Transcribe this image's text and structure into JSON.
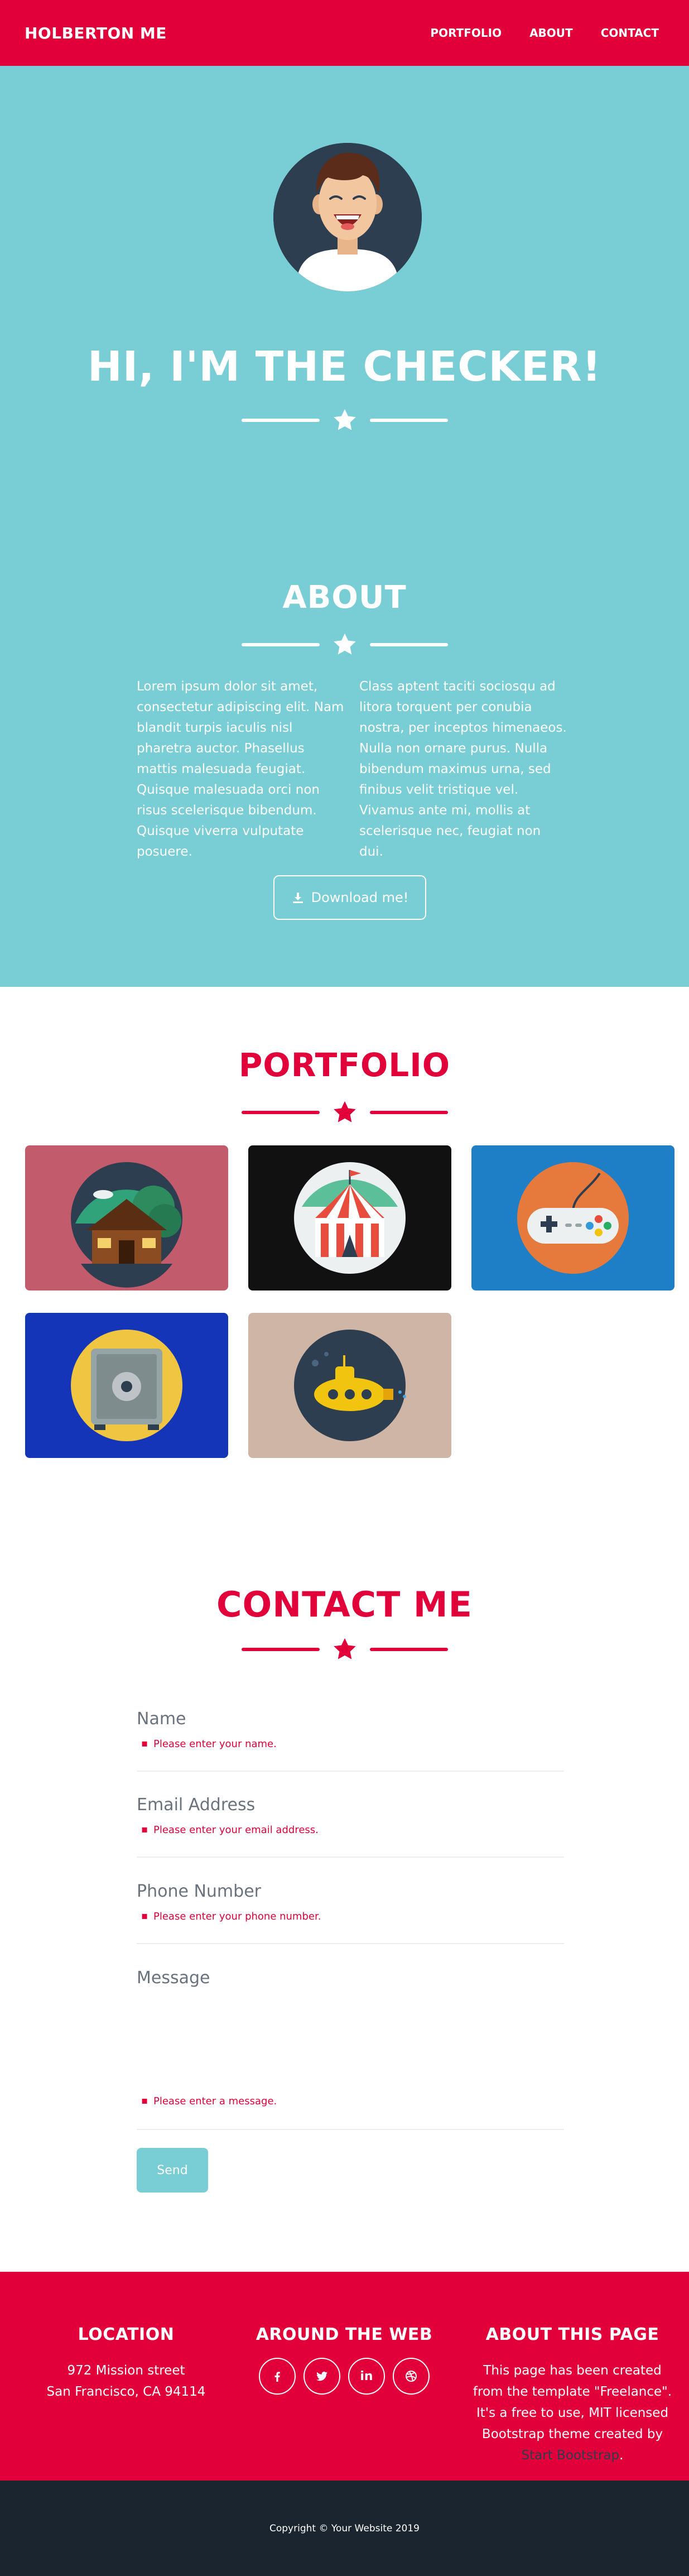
{
  "nav": {
    "brand": "HOLBERTON ME",
    "links": [
      "PORTFOLIO",
      "ABOUT",
      "CONTACT"
    ]
  },
  "hero": {
    "title": "HI, I'M THE CHECKER!"
  },
  "about": {
    "title": "ABOUT",
    "text_left": "Lorem ipsum dolor sit amet, consectetur adipiscing elit. Nam blandit turpis iaculis nisl pharetra auctor. Phasellus mattis malesuada feugiat. Quisque malesuada orci non risus scelerisque bibendum. Quisque viverra vulputate posuere.",
    "text_right": "Class aptent taciti sociosqu ad litora torquent per conubia nostra, per inceptos himenaeos. Nulla non ornare purus. Nulla bibendum maximus urna, sed finibus velit tristique vel. Vivamus ante mi, mollis at scelerisque nec, feugiat non dui.",
    "download_label": "Download me!"
  },
  "portfolio": {
    "title": "PORTFOLIO"
  },
  "contact": {
    "title": "CONTACT ME",
    "fields": [
      {
        "label": "Name",
        "error": "Please enter your name."
      },
      {
        "label": "Email Address",
        "error": "Please enter your email address."
      },
      {
        "label": "Phone Number",
        "error": "Please enter your phone number."
      },
      {
        "label": "Message",
        "error": "Please enter a message."
      }
    ],
    "send_label": "Send"
  },
  "footer": {
    "location_title": "LOCATION",
    "location_line1": "972 Mission street",
    "location_line2": "San Francisco, CA 94114",
    "web_title": "AROUND THE WEB",
    "socials": [
      "facebook-icon",
      "twitter-icon",
      "linkedin-icon",
      "dribbble-icon"
    ],
    "about_title": "ABOUT THIS PAGE",
    "about_text": "This page has been created from the template \"Freelance\". It's a free to use, MIT licensed Bootstrap theme created by",
    "about_link": "Start Bootstrap",
    "about_end": "."
  },
  "copyright": "Copyright © Your Website 2019",
  "colors": {
    "primary": "#e10039",
    "teal": "#79cdd4",
    "dark": "#2c3e50",
    "footer_dark": "#1a252f"
  }
}
